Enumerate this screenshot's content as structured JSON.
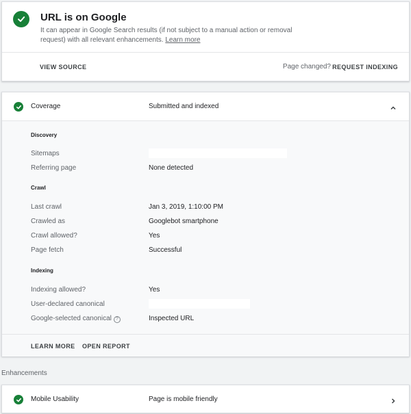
{
  "status": {
    "title": "URL is on Google",
    "description": "It can appear in Google Search results (if not subject to a manual action or removal request) with all relevant enhancements.",
    "learn_more": "Learn more",
    "view_source": "VIEW SOURCE",
    "page_changed": "Page changed?",
    "request_indexing": "REQUEST INDEXING"
  },
  "coverage": {
    "label": "Coverage",
    "value": "Submitted and indexed",
    "discovery": {
      "title": "Discovery",
      "sitemaps_label": "Sitemaps",
      "referring_label": "Referring page",
      "referring_value": "None detected"
    },
    "crawl": {
      "title": "Crawl",
      "last_crawl_label": "Last crawl",
      "last_crawl_value": "Jan 3, 2019, 1:10:00 PM",
      "crawled_as_label": "Crawled as",
      "crawled_as_value": "Googlebot smartphone",
      "crawl_allowed_label": "Crawl allowed?",
      "crawl_allowed_value": "Yes",
      "page_fetch_label": "Page fetch",
      "page_fetch_value": "Successful"
    },
    "indexing": {
      "title": "Indexing",
      "indexing_allowed_label": "Indexing allowed?",
      "indexing_allowed_value": "Yes",
      "user_canonical_label": "User-declared canonical",
      "google_canonical_label": "Google-selected canonical",
      "google_canonical_value": "Inspected URL"
    },
    "learn_more": "LEARN MORE",
    "open_report": "OPEN REPORT"
  },
  "enhancements": {
    "title": "Enhancements",
    "mobile_label": "Mobile Usability",
    "mobile_value": "Page is mobile friendly"
  },
  "colors": {
    "success": "#188038",
    "card": "#ffffff",
    "panel": "#f8f9fa",
    "background": "#f1f3f4"
  },
  "icons": {
    "status": "check-circle-icon",
    "help": "help-icon",
    "collapse": "chevron-up-icon",
    "expand": "chevron-right-icon"
  }
}
